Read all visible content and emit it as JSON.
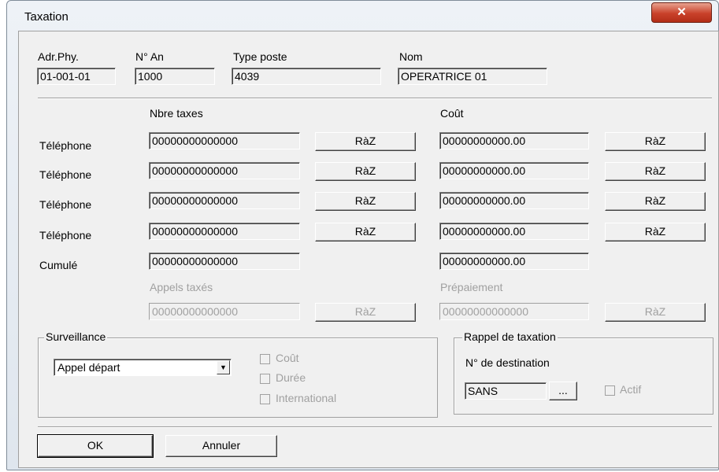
{
  "window": {
    "title": "Taxation",
    "close_label": "✕"
  },
  "header": {
    "adr_phy": {
      "label": "Adr.Phy.",
      "value": "01-001-01"
    },
    "n_an": {
      "label": "N° An",
      "value": "1000"
    },
    "type_poste": {
      "label": "Type poste",
      "value": "4039"
    },
    "nom": {
      "label": "Nom",
      "value": "OPERATRICE 01"
    }
  },
  "columns": {
    "nbre_taxes": "Nbre taxes",
    "cout": "Coût"
  },
  "rows": [
    {
      "label": "Téléphone",
      "taxes": "00000000000000",
      "taxes_btn": "RàZ",
      "cout": "00000000000.00",
      "cout_btn": "RàZ"
    },
    {
      "label": "Téléphone",
      "taxes": "00000000000000",
      "taxes_btn": "RàZ",
      "cout": "00000000000.00",
      "cout_btn": "RàZ"
    },
    {
      "label": "Téléphone",
      "taxes": "00000000000000",
      "taxes_btn": "RàZ",
      "cout": "00000000000.00",
      "cout_btn": "RàZ"
    },
    {
      "label": "Téléphone",
      "taxes": "00000000000000",
      "taxes_btn": "RàZ",
      "cout": "00000000000.00",
      "cout_btn": "RàZ"
    }
  ],
  "cumule": {
    "label": "Cumulé",
    "taxes": "00000000000000",
    "cout": "00000000000.00"
  },
  "appels_taxes": {
    "label": "Appels taxés",
    "value": "00000000000000",
    "btn": "RàZ"
  },
  "prepaiement": {
    "label": "Prépaiement",
    "value": "00000000000000",
    "btn": "RàZ"
  },
  "surveillance": {
    "legend": "Surveillance",
    "select_value": "Appel départ",
    "checkboxes": [
      "Coût",
      "Durée",
      "International"
    ]
  },
  "rappel": {
    "legend": "Rappel de taxation",
    "dest_label": "N° de destination",
    "dest_value": "SANS",
    "browse_label": "...",
    "actif_label": "Actif"
  },
  "footer": {
    "ok_label": "OK",
    "cancel_label": "Annuler"
  }
}
